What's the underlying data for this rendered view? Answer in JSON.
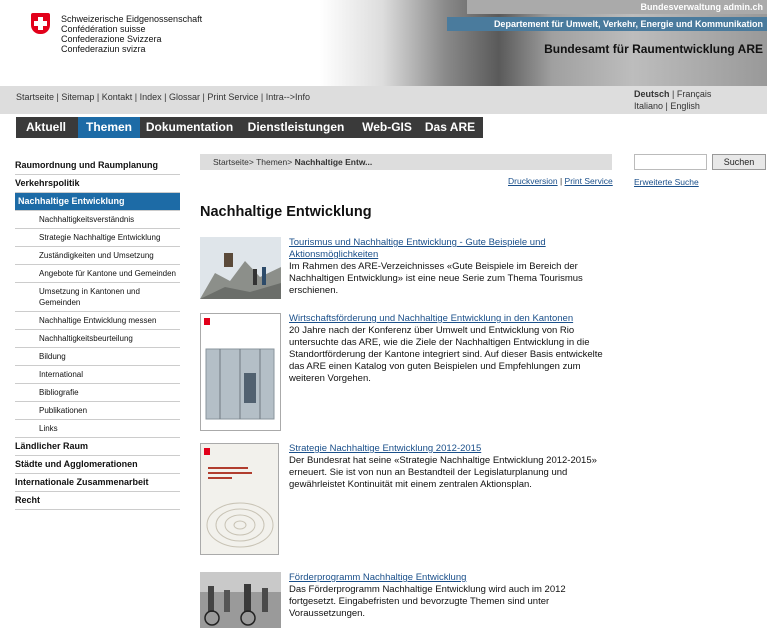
{
  "header": {
    "confederation_lines": [
      "Schweizerische Eidgenossenschaft",
      "Confédération suisse",
      "Confederazione Svizzera",
      "Confederaziun svizra"
    ],
    "bundesverwaltung": "Bundesverwaltung admin.ch",
    "department": "Departement für Umwelt, Verkehr, Energie und Kommunikation",
    "office": "Bundesamt für Raumentwicklung ARE"
  },
  "utility_links": [
    "Startseite",
    "Sitemap",
    "Kontakt",
    "Index",
    "Glossar",
    "Print Service",
    "Intra-->Info"
  ],
  "languages": {
    "current": "Deutsch",
    "others": [
      "Français",
      "Italiano",
      "English"
    ]
  },
  "nav": [
    "Aktuell",
    "Themen",
    "Dokumentation",
    "Dienstleistungen",
    "Web-GIS",
    "Das ARE"
  ],
  "nav_active": "Themen",
  "sidebar": [
    {
      "label": "Raumordnung und Raumplanung",
      "level": "top"
    },
    {
      "label": "Verkehrspolitik",
      "level": "top"
    },
    {
      "label": "Nachhaltige Entwicklung",
      "level": "active"
    },
    {
      "label": "Nachhaltigkeitsverständnis",
      "level": "sub"
    },
    {
      "label": "Strategie Nachhaltige Entwicklung",
      "level": "sub"
    },
    {
      "label": "Zuständigkeiten und Umsetzung",
      "level": "sub"
    },
    {
      "label": "Angebote für Kantone und Gemeinden",
      "level": "sub"
    },
    {
      "label": "Umsetzung in Kantonen und Gemeinden",
      "level": "sub"
    },
    {
      "label": "Nachhaltige Entwicklung messen",
      "level": "sub"
    },
    {
      "label": "Nachhaltigkeitsbeurteilung",
      "level": "sub"
    },
    {
      "label": "Bildung",
      "level": "sub"
    },
    {
      "label": "International",
      "level": "sub"
    },
    {
      "label": "Bibliografie",
      "level": "sub"
    },
    {
      "label": "Publikationen",
      "level": "sub"
    },
    {
      "label": "Links",
      "level": "sub"
    },
    {
      "label": "Ländlicher Raum",
      "level": "top"
    },
    {
      "label": "Städte und Agglomerationen",
      "level": "top"
    },
    {
      "label": "Internationale Zusammenarbeit",
      "level": "top"
    },
    {
      "label": "Recht",
      "level": "top"
    }
  ],
  "breadcrumb": {
    "path": "Startseite> Themen> ",
    "current": "Nachhaltige Entw..."
  },
  "print_links": {
    "druck": "Druckversion",
    "sep": " | ",
    "service": "Print Service"
  },
  "page_title": "Nachhaltige Entwicklung",
  "search": {
    "placeholder": "",
    "button": "Suchen",
    "advanced": "Erweiterte Suche"
  },
  "articles": [
    {
      "title": "Tourismus und Nachhaltige Entwicklung - Gute Beispiele und Aktionsmöglichkeiten",
      "text": "Im Rahmen des ARE-Verzeichnisses «Gute Beispiele im Bereich der Nachhaltigen Entwicklung» ist eine neue Serie zum Thema Tourismus erschienen."
    },
    {
      "title": "Wirtschaftsförderung und Nachhaltige Entwicklung in den Kantonen",
      "text": "20 Jahre nach der Konferenz über Umwelt und Entwicklung von Rio untersuchte das ARE, wie die Ziele der Nachhaltigen Entwicklung in die Standortförderung der Kantone integriert sind. Auf dieser Basis entwickelte das ARE einen Katalog von guten Beispielen und Empfehlungen zum weiteren Vorgehen."
    },
    {
      "title": "Strategie Nachhaltige Entwicklung 2012-2015",
      "text": "Der Bundesrat hat seine «Strategie Nachhaltige Entwicklung 2012-2015» erneuert. Sie ist von nun an Bestandteil der Legislaturplanung und gewährleistet Kontinuität mit einem zentralen Aktionsplan."
    },
    {
      "title": "Förderprogramm Nachhaltige Entwicklung",
      "text": "Das Förderprogramm Nachhaltige Entwicklung wird auch im 2012 fortgesetzt. Eingabefristen und bevorzugte Themen sind unter Voraussetzungen."
    }
  ]
}
